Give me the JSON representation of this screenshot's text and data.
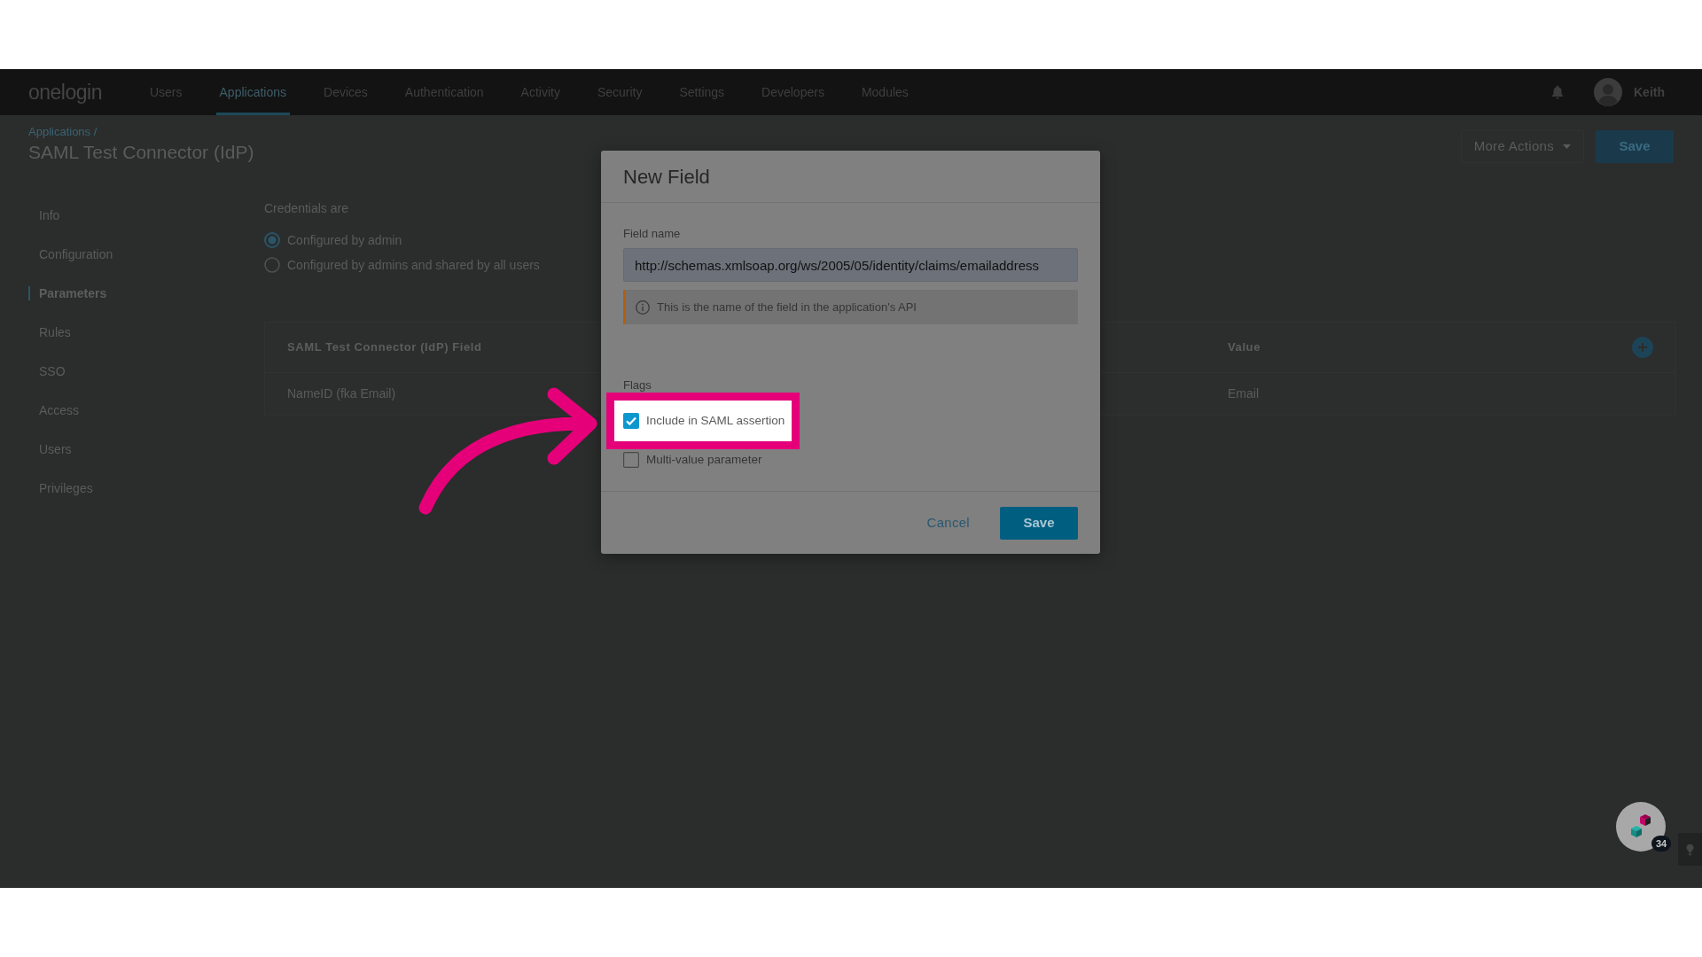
{
  "nav": {
    "logo": "onelogin",
    "items": [
      {
        "label": "Users",
        "selected": false
      },
      {
        "label": "Applications",
        "selected": true
      },
      {
        "label": "Devices",
        "selected": false
      },
      {
        "label": "Authentication",
        "selected": false
      },
      {
        "label": "Activity",
        "selected": false
      },
      {
        "label": "Security",
        "selected": false
      },
      {
        "label": "Settings",
        "selected": false
      },
      {
        "label": "Developers",
        "selected": false
      },
      {
        "label": "Modules",
        "selected": false
      }
    ],
    "user": {
      "name": "Keith"
    }
  },
  "header": {
    "breadcrumb": "Applications /",
    "title": "SAML Test Connector (IdP)",
    "buttons": [
      {
        "label": "More Actions",
        "kind": "menu"
      },
      {
        "label": "Save",
        "kind": "primary"
      }
    ]
  },
  "sidebar": {
    "items": [
      {
        "label": "Info",
        "selected": false
      },
      {
        "label": "Configuration",
        "selected": false
      },
      {
        "label": "Parameters",
        "selected": true
      },
      {
        "label": "Rules",
        "selected": false
      },
      {
        "label": "SSO",
        "selected": false
      },
      {
        "label": "Access",
        "selected": false
      },
      {
        "label": "Users",
        "selected": false
      },
      {
        "label": "Privileges",
        "selected": false
      }
    ]
  },
  "credentials": {
    "label": "Credentials are",
    "options": [
      {
        "label": "Configured by admin",
        "selected": true
      },
      {
        "label": "Configured by admins and shared by all users",
        "selected": false
      }
    ]
  },
  "table": {
    "columns": [
      "SAML Test Connector (IdP) Field",
      "Value"
    ],
    "rows": [
      [
        "NameID (fka Email)",
        "Email"
      ]
    ]
  },
  "dialog": {
    "title": "New Field",
    "field_name": {
      "label": "Field name",
      "value": "http://schemas.xmlsoap.org/ws/2005/05/identity/claims/emailaddress"
    },
    "hint": "This is the name of the field in the application's API",
    "flags": {
      "label": "Flags",
      "options": [
        {
          "label": "Include in SAML assertion",
          "checked": true,
          "highlighted": true
        },
        {
          "label": "Multi-value parameter",
          "checked": false,
          "highlighted": false
        }
      ]
    },
    "buttons": [
      {
        "label": "Cancel",
        "kind": "text"
      },
      {
        "label": "Save",
        "kind": "primary"
      }
    ]
  },
  "help_widget": {
    "badge": "34"
  }
}
